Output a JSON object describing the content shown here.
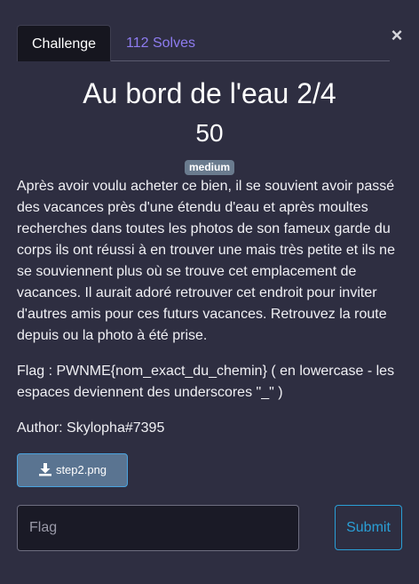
{
  "tabs": {
    "challenge_label": "Challenge",
    "solves_label": "112 Solves"
  },
  "close_label": "×",
  "challenge": {
    "title": "Au bord de l'eau 2/4",
    "points": "50",
    "difficulty": "medium",
    "description": "Après avoir voulu acheter ce bien, il se souvient avoir passé des vacances près d'une étendu d'eau et après moultes recherches dans toutes les photos de son fameux garde du corps ils ont réussi à en trouver une mais très petite et ils ne se souviennent plus où se trouve cet emplacement de vacances. Il aurait adoré retrouver cet endroit pour inviter d'autres amis pour ces futurs vacances. Retrouvez la route depuis ou la photo à été prise.",
    "flag_format": "Flag : PWNME{nom_exact_du_chemin} ( en lowercase - les espaces deviennent des underscores \"_\" )",
    "author": "Author: Skylopha#7395"
  },
  "file": {
    "name": "step2.png",
    "icon": "download-icon"
  },
  "form": {
    "flag_placeholder": "Flag",
    "flag_value": "",
    "submit_label": "Submit"
  },
  "colors": {
    "background": "#2e2e41",
    "accent": "#2a9fd6",
    "solves_link": "#8e7cf0",
    "badge": "#6a7b8e"
  }
}
